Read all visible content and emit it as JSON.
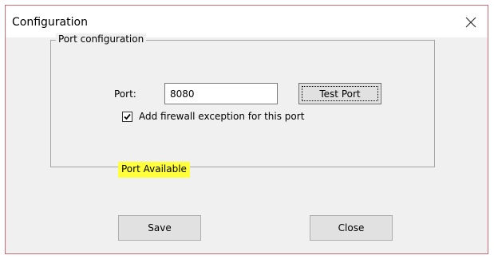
{
  "window": {
    "title": "Configuration"
  },
  "group": {
    "legend": "Port configuration"
  },
  "port": {
    "label": "Port:",
    "value": "8080"
  },
  "test_port_button": {
    "label": "Test Port"
  },
  "firewall_checkbox": {
    "label": "Add firewall exception for this port",
    "checked": true
  },
  "status": {
    "text": "Port Available",
    "highlight_color": "#ffff3b"
  },
  "buttons": {
    "save_label": "Save",
    "close_label": "Close"
  },
  "colors": {
    "window_border": "#d06a74",
    "client_background": "#f0f0f0",
    "button_face": "#e1e1e1"
  },
  "icons": {
    "title_close": "close-icon",
    "checkbox_mark": "checkmark-icon"
  }
}
